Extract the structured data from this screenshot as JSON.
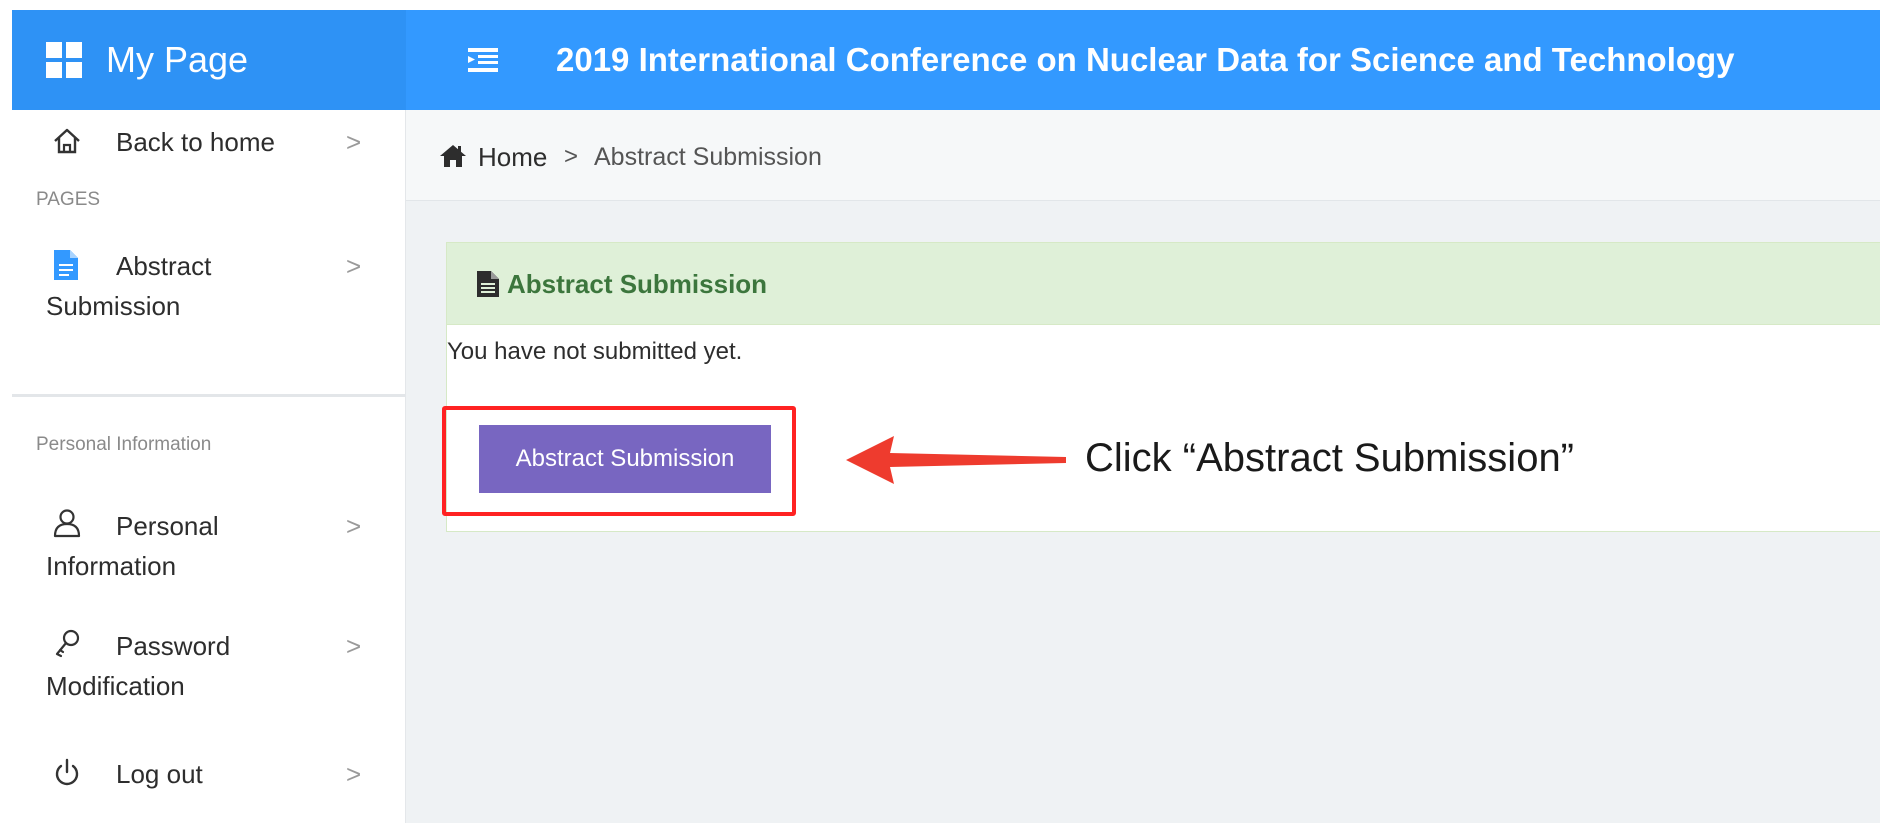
{
  "header": {
    "brand": "My Page",
    "title": "2019 International Conference on Nuclear Data for Science and Technology",
    "brand_icon": "grid-icon",
    "toggle_icon": "menu-toggle-icon"
  },
  "sidebar": {
    "back": {
      "label": "Back to home",
      "icon": "home-icon"
    },
    "section_pages": "PAGES",
    "abstract": {
      "label_line1": "Abstract",
      "label_line2": "Submission",
      "icon": "document-icon"
    },
    "section_personal": "Personal Information",
    "personal": {
      "label_line1": "Personal",
      "label_line2": "Information",
      "icon": "user-icon"
    },
    "password": {
      "label_line1": "Password",
      "label_line2": "Modification",
      "icon": "key-icon"
    },
    "logout": {
      "label": "Log out",
      "icon": "power-icon"
    },
    "chevron": ">"
  },
  "breadcrumb": {
    "home": "Home",
    "separator": ">",
    "current": "Abstract Submission"
  },
  "panel": {
    "title": "Abstract Submission",
    "message": "You have not submitted yet.",
    "button_label": "Abstract Submission"
  },
  "annotation": {
    "text": "Click “Abstract Submission”",
    "color": "#ff2222"
  },
  "colors": {
    "header": "#3399ff",
    "brand_bg": "#2e92f5",
    "button": "#7866c1",
    "panel_heading": "#dff0d8",
    "panel_title": "#3c763d",
    "content_bg": "#eff2f4"
  }
}
